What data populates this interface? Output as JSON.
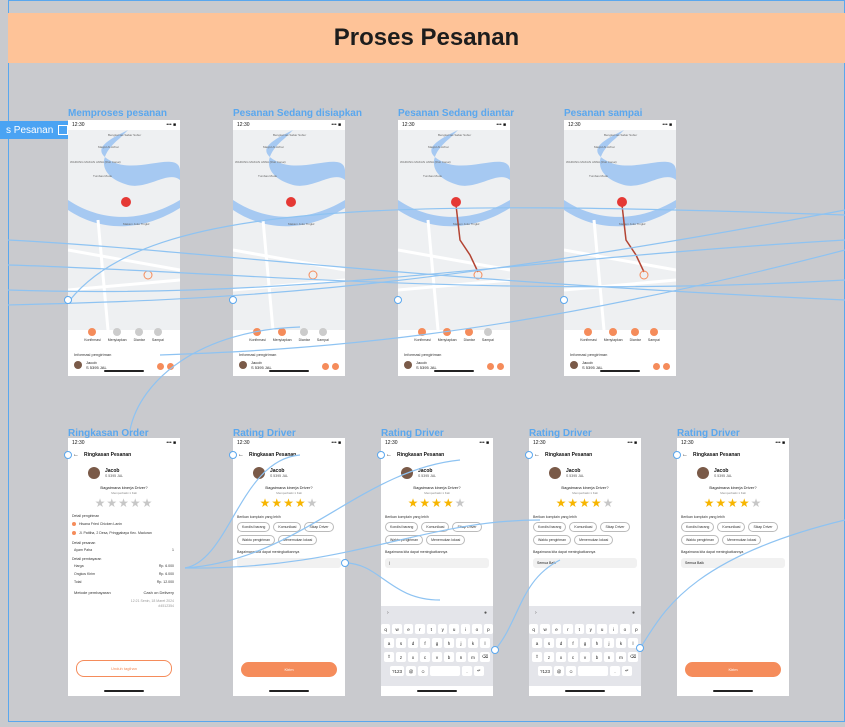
{
  "banner": {
    "title": "Proses Pesanan"
  },
  "side_tab": {
    "label": "s Pesanan"
  },
  "colors": {
    "accent": "#f58c5b",
    "wire": "#5aa7ee",
    "banner_bg": "#fec398"
  },
  "status_bar": {
    "time": "12:30",
    "icons": "••• ■"
  },
  "progress_frames": [
    {
      "label": "Memproses pesanan",
      "done": 1
    },
    {
      "label": "Pesanan Sedang disiapkan",
      "done": 2
    },
    {
      "label": "Pesanan Sedang diantar",
      "done": 3
    },
    {
      "label": "Pesanan sampai",
      "done": 4
    }
  ],
  "map": {
    "places": [
      "Bengkel las Sabar Subur",
      "Masjid Al-Azhar",
      "WARUNG MAKAN JAWA (Roti Canai)",
      "Tumbas Mode",
      "Makam Joko Tingkir",
      "Jembatan Lawang",
      "IMP Kanebaru",
      "PPTQ \"RODLOTUL QUR'AN\" Lamongan",
      "LA Shoe Room",
      "KOMPI MADURAN"
    ]
  },
  "steps": [
    "Konfirmasi",
    "Menyiapkan",
    "Diantar",
    "Sampai"
  ],
  "info": {
    "title": "Informasi pengiriman",
    "driver": "Jacob",
    "plate": "S 5395 JAL"
  },
  "summary": {
    "frame_label": "Ringkasan Order",
    "header": "Ringkasan Pesanan",
    "question": "Bagaimana kinerja Driver?",
    "question_sub": "Memperbaiki 1 Kali",
    "address_label": "Detail pengiriman",
    "restaurant": "Hisana Fried Chicken Lanin",
    "address": "Jl. Pattiha, 2 Desa, Pringgabaya Kec. Maduran",
    "detail_label": "Detail pesanan",
    "item": "Ayam Paha",
    "item_qty": "1",
    "pay_label": "Detail pembayaran",
    "lines": [
      {
        "name": "Harga",
        "value": "Rp. 6.000"
      },
      {
        "name": "Ongkos Kirim",
        "value": "Rp. 6.000"
      },
      {
        "name": "Total",
        "value": "Rp. 12.000"
      }
    ],
    "method_label": "Metode pembayaran",
    "method": "Cash on Delivery",
    "timestamp": "12:21 Senin, 18 Maret 2024",
    "order_no": "#4512354",
    "button": "Unduh tagihan"
  },
  "rating_frames": [
    {
      "label": "Rating Driver",
      "stars": 4,
      "keyboard": false,
      "text": "",
      "button": "Kirim"
    },
    {
      "label": "Rating Driver",
      "stars": 4,
      "keyboard": true,
      "text": "|",
      "button": ""
    },
    {
      "label": "Rating Driver",
      "stars": 4,
      "keyboard": true,
      "text": "Semua Baik",
      "button": ""
    },
    {
      "label": "Rating Driver",
      "stars": 4,
      "keyboard": false,
      "text": "Semua Baik",
      "button": "Kirim"
    }
  ],
  "rating": {
    "header": "Ringkasan Pesanan",
    "driver": "Jacob",
    "plate": "S 5395 JAL",
    "question": "Bagaimana kinerja Driver?",
    "question_sub": "Memperbaiki 1 Kali",
    "chips_label": "Berikan komplain yang lebih",
    "chips": [
      "Kondisi barang",
      "Komunikasi",
      "Sikap Driver",
      "Waktu pengiriman",
      "Menemukan lokasi"
    ],
    "comment_label": "Bagaimana kita dapat meningkatkannya"
  },
  "keyboard": {
    "rows": [
      [
        "q",
        "w",
        "e",
        "r",
        "t",
        "y",
        "u",
        "i",
        "o",
        "p"
      ],
      [
        "a",
        "s",
        "d",
        "f",
        "g",
        "h",
        "j",
        "k",
        "l"
      ],
      [
        "⇧",
        "z",
        "x",
        "c",
        "v",
        "b",
        "n",
        "m",
        "⌫"
      ],
      [
        "?123",
        "@",
        "☺",
        " ",
        ".",
        "↵"
      ]
    ]
  }
}
